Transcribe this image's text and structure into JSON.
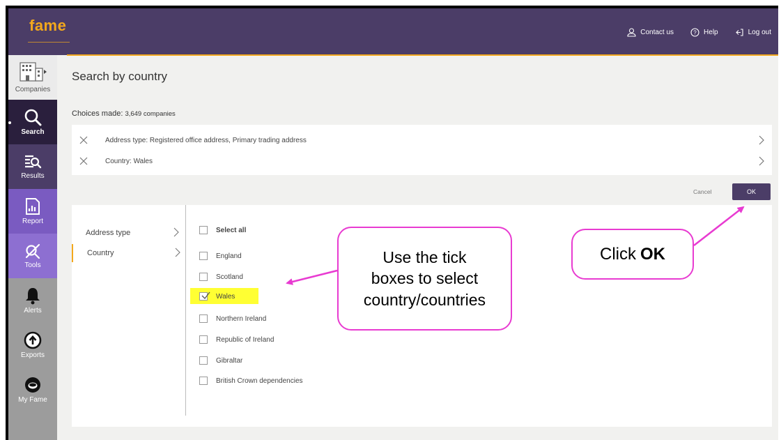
{
  "brand": {
    "logo": "fame",
    "accent": "#f3a81c",
    "primary": "#4b3d67",
    "callout_border": "#e83bd1",
    "highlight": "#ffff33"
  },
  "topnav": [
    {
      "label": "Contact us",
      "icon": "person-icon"
    },
    {
      "label": "Help",
      "icon": "help-circle-icon"
    },
    {
      "label": "Log out",
      "icon": "logout-icon"
    }
  ],
  "sidebar": {
    "items": [
      {
        "label": "Companies",
        "icon": "companies-icon"
      },
      {
        "label": "Search",
        "icon": "search-icon",
        "active": true
      },
      {
        "label": "Results",
        "icon": "results-icon"
      },
      {
        "label": "Report",
        "icon": "report-icon"
      },
      {
        "label": "Tools",
        "icon": "tools-icon"
      },
      {
        "label": "Alerts",
        "icon": "bell-icon"
      },
      {
        "label": "Exports",
        "icon": "export-icon"
      },
      {
        "label": "My Fame",
        "icon": "myfame-icon"
      }
    ]
  },
  "main": {
    "title": "Search by country",
    "choices_label": "Choices made:",
    "choices_count": "3,649 companies",
    "choices": [
      {
        "text": "Address type: Registered office address, Primary trading address"
      },
      {
        "text": "Country: Wales"
      }
    ],
    "cancel_label": "Cancel",
    "ok_label": "OK"
  },
  "criteria_nav": [
    {
      "label": "Address type"
    },
    {
      "label": "Country",
      "selected": true
    }
  ],
  "countries": {
    "select_all_label": "Select all",
    "options": [
      {
        "label": "England",
        "checked": false
      },
      {
        "label": "Scotland",
        "checked": false
      },
      {
        "label": "Wales",
        "checked": true
      },
      {
        "label": "Northern Ireland",
        "checked": false
      },
      {
        "label": "Republic of Ireland",
        "checked": false
      },
      {
        "label": "Gibraltar",
        "checked": false
      },
      {
        "label": "British Crown dependencies",
        "checked": false
      }
    ]
  },
  "callouts": {
    "tick_lines": [
      "Use the tick",
      "boxes to select",
      "country/countries"
    ],
    "ok_prefix": "Click",
    "ok_bold": "OK"
  }
}
